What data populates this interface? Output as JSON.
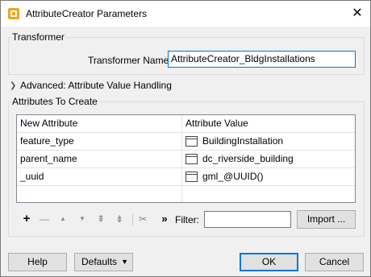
{
  "window": {
    "title": "AttributeCreator Parameters",
    "close_glyph": "✕"
  },
  "transformer_group": {
    "title": "Transformer",
    "name_label": "Transformer Name:",
    "name_value": "AttributeCreator_BldgInstallations"
  },
  "advanced": {
    "label": "Advanced: Attribute Value Handling",
    "expanded": false
  },
  "attributes_group": {
    "title": "Attributes To Create",
    "columns": [
      "New Attribute",
      "Attribute Value"
    ],
    "rows": [
      {
        "name": "feature_type",
        "value": "BuildingInstallation",
        "value_icon": "text-value-icon"
      },
      {
        "name": "parent_name",
        "value": "dc_riverside_building",
        "value_icon": "text-value-icon"
      },
      {
        "name": "_uuid",
        "value": "gml_@UUID()",
        "value_icon": "text-value-icon"
      }
    ],
    "toolbar": {
      "add": "+",
      "remove": "—",
      "move_up": "▲",
      "move_down": "▼",
      "move_top": "⇞",
      "move_bottom": "⇟",
      "cut": "✂",
      "expand": "»"
    },
    "filter_label": "Filter:",
    "filter_value": "",
    "import_label": "Import ..."
  },
  "footer": {
    "help_label": "Help",
    "defaults_label": "Defaults",
    "defaults_arrow": "▼",
    "ok_label": "OK",
    "cancel_label": "Cancel"
  }
}
